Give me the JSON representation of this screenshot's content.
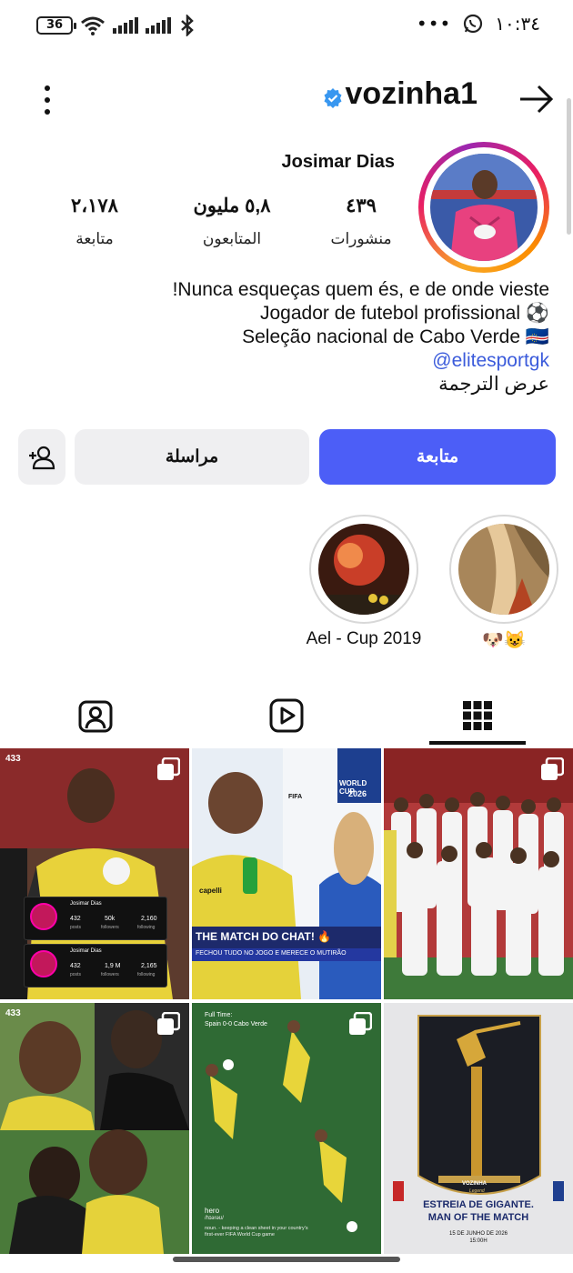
{
  "status_bar": {
    "battery": "36",
    "time": "١٠:٣٤"
  },
  "header": {
    "username": "vozinha1"
  },
  "profile": {
    "display_name": "Josimar Dias",
    "stats": {
      "posts_value": "٤٣٩",
      "posts_label": "منشورات",
      "followers_value": "٥,٨ مليون",
      "followers_label": "المتابعون",
      "following_value": "٢،١٧٨",
      "following_label": "متابعة"
    },
    "bio": {
      "line1": "!Nunca esqueças quem és, e de onde vieste",
      "line2": "Jogador de futebol profissional ⚽",
      "line3": "Seleção nacional de Cabo Verde 🇨🇻",
      "link": "@elitesportgk",
      "see_translation": "عرض الترجمة"
    }
  },
  "actions": {
    "follow": "متابعة",
    "message": "مراسلة"
  },
  "highlights": [
    {
      "caption": "🐶😺"
    },
    {
      "caption": "Ael - Cup 2019"
    }
  ],
  "posts": {
    "p1": {
      "badge": "433",
      "card_name": "Josimar Dias",
      "card1": {
        "posts": "432",
        "followers": "50k",
        "following": "2,160"
      },
      "card2": {
        "posts": "432",
        "followers": "1,9 M",
        "following": "2,165"
      },
      "labels": {
        "posts": "posts",
        "followers": "followers",
        "following": "following"
      }
    },
    "p2": {
      "event": "WORLD CUP",
      "year": "2026",
      "fifa": "FIFA",
      "banner1": "THE MATCH DO CHAT! 🔥",
      "banner2": "FECHOU TUDO NO JOGO E MERECE O MUTIRÃO",
      "sponsor": "capelli"
    },
    "p4": {
      "badge": "433"
    },
    "p5": {
      "header1": "Full Time:",
      "header2": "Spain 0-0 Cabo Verde",
      "word": "hero",
      "pron": "/hɪərəʊ/",
      "def": "noun. - keeping a clean sheet in your country's first-ever FIFA World Cup game"
    },
    "p6": {
      "name": "VOZINHA",
      "sub": "Legend",
      "title1": "ESTREIA DE GIGANTE.",
      "title2": "MAN OF THE MATCH",
      "date": "15 DE JUNHO DE 2026",
      "time": "15:00H"
    }
  },
  "colors": {
    "follow_button": "#4c5ef7",
    "secondary_button": "#efeff1",
    "verified": "#3897f0",
    "link": "#3b5bdb"
  }
}
